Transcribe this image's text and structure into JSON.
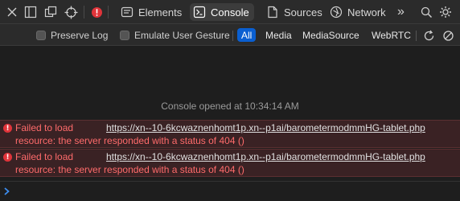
{
  "toolbar": {
    "tabs": [
      {
        "label": "Elements",
        "icon": "elements-icon"
      },
      {
        "label": "Console",
        "icon": "console-icon",
        "active": true
      },
      {
        "label": "Sources",
        "icon": "sources-icon"
      },
      {
        "label": "Network",
        "icon": "network-icon"
      }
    ],
    "overflow": "»"
  },
  "filters": {
    "preserve_log": "Preserve Log",
    "emulate_gesture": "Emulate User Gesture",
    "buttons": [
      "All",
      "Media",
      "MediaSource",
      "WebRTC"
    ],
    "active": "All"
  },
  "console": {
    "opened": "Console opened at 10:34:14 AM",
    "messages": [
      {
        "prefix": "Failed to load",
        "url": "https://xn--10-6kcwaznenhomt1p.xn--p1ai/barometermodmmHG-tablet.php",
        "detail": "resource: the server responded with a status of 404 ()"
      },
      {
        "prefix": "Failed to load",
        "url": "https://xn--10-6kcwaznenhomt1p.xn--p1ai/barometermodmmHG-tablet.php",
        "detail": "resource: the server responded with a status of 404 ()"
      }
    ]
  },
  "colors": {
    "accent": "#0a5fd1",
    "error": "#ff6b6b",
    "error_bg": "#3a2224"
  }
}
